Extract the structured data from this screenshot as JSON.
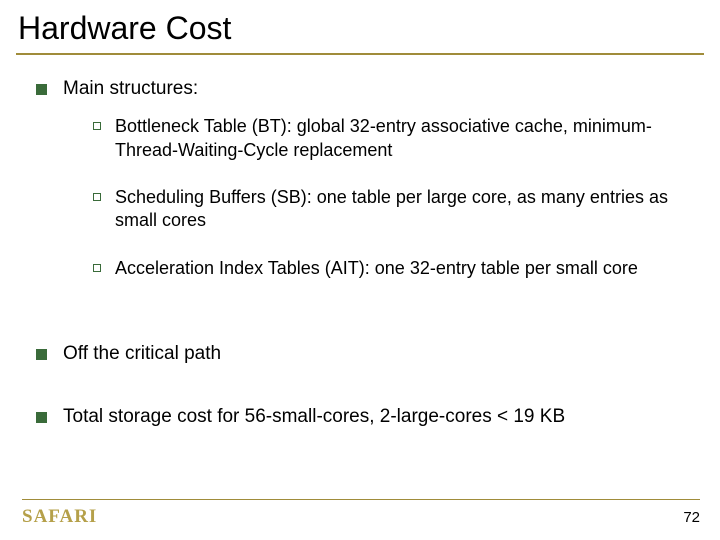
{
  "title": "Hardware Cost",
  "bullets": {
    "b0": {
      "label": "Main structures:",
      "subs": {
        "s0": "Bottleneck Table (BT): global 32-entry associative cache, minimum-Thread-Waiting-Cycle replacement",
        "s1": "Scheduling Buffers (SB): one table per large core, as many entries as small cores",
        "s2": "Acceleration Index Tables (AIT): one 32-entry table per small core"
      }
    },
    "b1": {
      "label": "Off the critical path"
    },
    "b2": {
      "label": "Total storage cost for 56-small-cores, 2-large-cores < 19 KB"
    }
  },
  "footer": {
    "logo": "SAFARI",
    "page": "72"
  }
}
